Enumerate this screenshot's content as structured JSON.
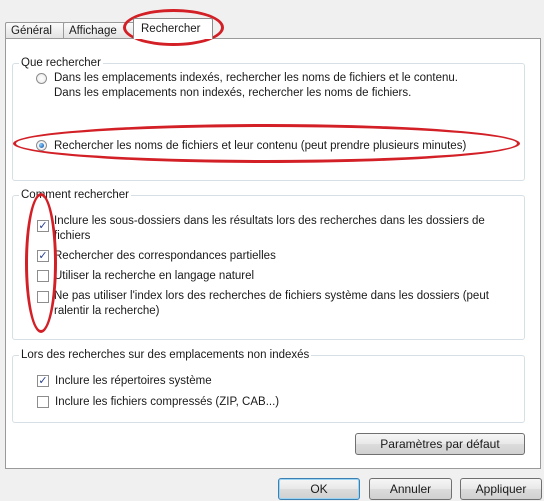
{
  "tabs": [
    {
      "label": "Général"
    },
    {
      "label": "Affichage"
    },
    {
      "label": "Rechercher"
    }
  ],
  "search_what": {
    "title": "Que rechercher",
    "option1_line1": "Dans les emplacements indexés, rechercher les noms de fichiers et le contenu.",
    "option1_line2": "Dans les emplacements non indexés, rechercher les noms de fichiers.",
    "option2": "Rechercher les noms de fichiers et leur contenu (peut prendre plusieurs minutes)"
  },
  "how_search": {
    "title": "Comment rechercher",
    "opt1_line1": "Inclure les sous-dossiers dans les résultats lors des recherches dans les dossiers de",
    "opt1_line2": "fichiers",
    "opt2": "Rechercher des correspondances partielles",
    "opt3": "Utiliser la recherche en langage naturel",
    "opt4_line1": "Ne pas utiliser l'index lors des recherches de fichiers système dans les dossiers (peut",
    "opt4_line2": "ralentir la recherche)"
  },
  "non_indexed": {
    "title": "Lors des recherches sur des emplacements non indexés",
    "opt1": "Inclure les répertoires système",
    "opt2": "Inclure les fichiers compressés (ZIP, CAB...)"
  },
  "buttons": {
    "defaults": "Paramètres par défaut",
    "ok": "OK",
    "cancel": "Annuler",
    "apply": "Appliquer"
  },
  "checkbox_states": {
    "how_1": true,
    "how_2": true,
    "how_3": false,
    "how_4": false,
    "non_indexed_1": true,
    "non_indexed_2": false
  },
  "colors": {
    "annotation": "#d31f26",
    "selection": "#1b62b5"
  }
}
